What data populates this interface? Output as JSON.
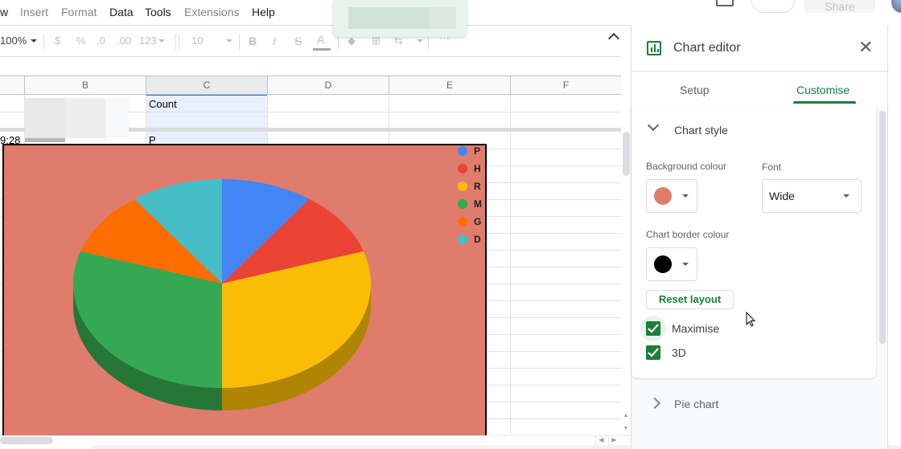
{
  "menu": {
    "items": [
      {
        "label": "w",
        "enabled": true
      },
      {
        "label": "Insert",
        "enabled": false
      },
      {
        "label": "Format",
        "enabled": false
      },
      {
        "label": "Data",
        "enabled": true
      },
      {
        "label": "Tools",
        "enabled": true
      },
      {
        "label": "Extensions",
        "enabled": false
      },
      {
        "label": "Help",
        "enabled": true
      }
    ]
  },
  "header": {
    "share_label": "Share",
    "icons": [
      "comment-icon",
      "add-icon",
      "avatar"
    ]
  },
  "toolbar": {
    "zoom": "100%",
    "currency": "$",
    "percent": "%",
    "decrease_decimal": ".0",
    "increase_decimal": ".00",
    "number_format": "123",
    "font_size": "10",
    "bold": "B",
    "italic": "I",
    "strikethrough": "S",
    "text_color": "A",
    "more": "⋯",
    "icons": [
      "fill-color-icon",
      "borders-icon",
      "merge-icon",
      "collapse-toolbar-icon"
    ]
  },
  "grid": {
    "columns": [
      "B",
      "C",
      "D",
      "E",
      "F"
    ],
    "selected_column": "C",
    "cells": {
      "C1": "Count",
      "C3": "P",
      "A3_partial": "9:28"
    }
  },
  "chart_data": {
    "type": "pie",
    "variant": "3d",
    "title": "",
    "background_color": "#df7c6b",
    "border_color": "#000000",
    "legend_position": "top-right",
    "categories": [
      "P",
      "H",
      "R",
      "M",
      "G",
      "D"
    ],
    "values": [
      1,
      1,
      3,
      3,
      1,
      1
    ],
    "colors": [
      "#4285f4",
      "#ea4335",
      "#fbbc04",
      "#34a853",
      "#ff6d01",
      "#46bdc6"
    ],
    "side_colors": [
      "#2f5fb0",
      "#a32f25",
      "#b08503",
      "#257637",
      "#b34d01",
      "#318489"
    ]
  },
  "editor": {
    "title": "Chart editor",
    "tabs": [
      {
        "label": "Setup",
        "active": false
      },
      {
        "label": "Customise",
        "active": true
      }
    ],
    "sections": {
      "chart_style": {
        "title": "Chart style",
        "expanded": true,
        "background_colour_label": "Background colour",
        "background_colour": "#df7c6b",
        "font_label": "Font",
        "font_value": "Wide",
        "border_colour_label": "Chart border colour",
        "border_colour": "#000000",
        "reset_label": "Reset layout",
        "checkboxes": [
          {
            "label": "Maximise",
            "checked": true
          },
          {
            "label": "3D",
            "checked": true
          }
        ]
      },
      "pie_chart": {
        "title": "Pie chart",
        "expanded": false
      }
    }
  },
  "colors": {
    "accent": "#188038",
    "selection": "#1a73e8"
  }
}
